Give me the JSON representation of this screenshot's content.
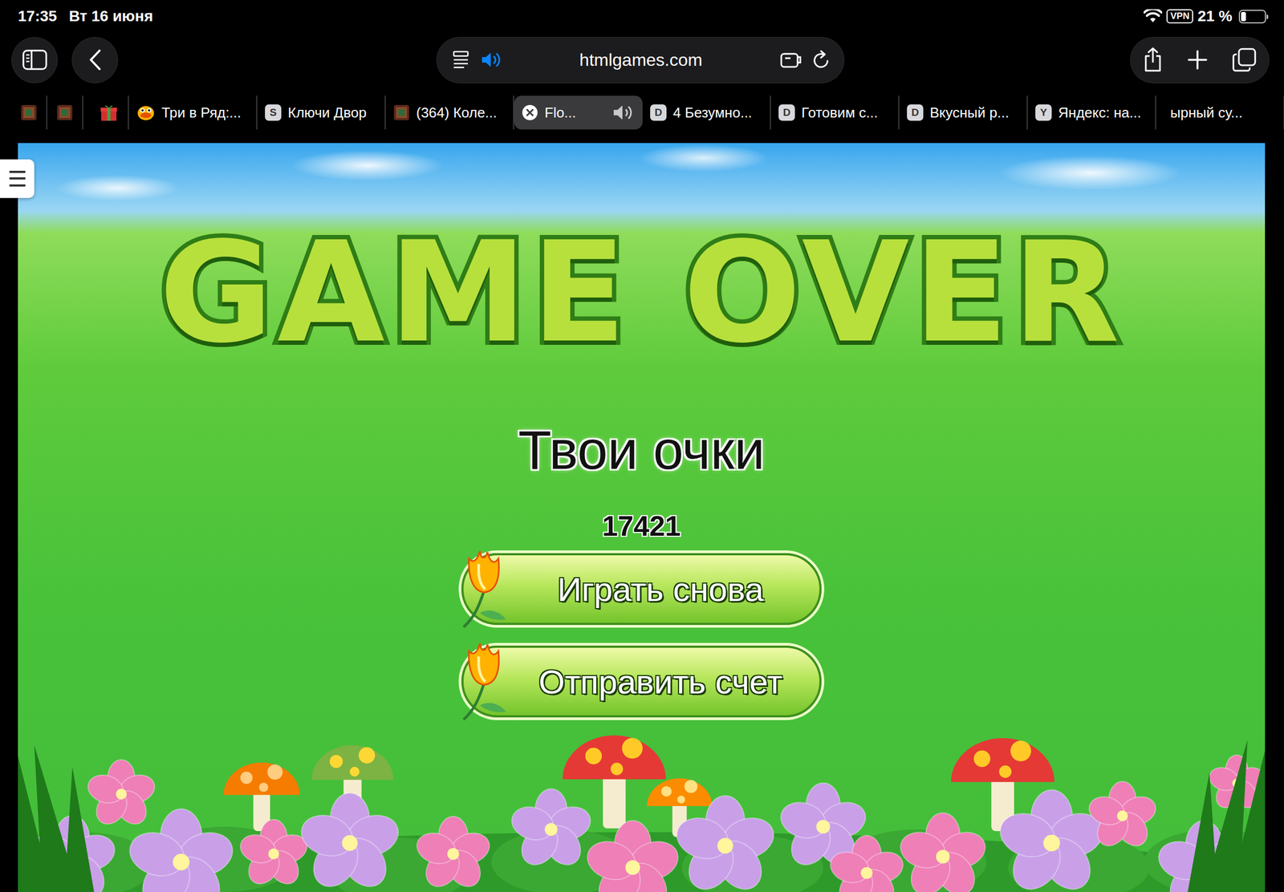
{
  "status_bar": {
    "time": "17:35",
    "date": "Вт 16 июня",
    "vpn": "VPN",
    "battery": "21 %",
    "battery_level": 0.21
  },
  "toolbar": {
    "address": "htmlgames.com",
    "audio_playing": true
  },
  "tabs": [
    {
      "kind": "image",
      "selected": false,
      "audio": false
    },
    {
      "kind": "image",
      "selected": false,
      "audio": false
    },
    {
      "kind": "gift",
      "selected": false,
      "audio": false
    },
    {
      "kind": "bird",
      "label": "Три в Ряд:...",
      "selected": false,
      "audio": false
    },
    {
      "kind": "letter",
      "favicon": "S",
      "label": "Ключи Двор",
      "selected": false,
      "audio": false
    },
    {
      "kind": "image",
      "label": "(364) Коле...",
      "selected": false,
      "audio": false
    },
    {
      "kind": "close",
      "label": "Flo...",
      "selected": true,
      "audio": true
    },
    {
      "kind": "letter",
      "favicon": "D",
      "label": "4 Безумно...",
      "selected": false,
      "audio": false
    },
    {
      "kind": "letter",
      "favicon": "D",
      "label": "Готовим с...",
      "selected": false,
      "audio": false
    },
    {
      "kind": "letter",
      "favicon": "D",
      "label": "Вкусный р...",
      "selected": false,
      "audio": false
    },
    {
      "kind": "letter",
      "favicon": "Y",
      "label": "Яндекс: на...",
      "selected": false,
      "audio": false
    },
    {
      "kind": "none",
      "label": "ырный су...",
      "selected": false,
      "audio": false
    }
  ],
  "game": {
    "menu_icon": "☰",
    "title": "GAME OVER",
    "score_label": "Твои очки",
    "score": "17421",
    "buttons": [
      "Играть снова",
      "Отправить счет"
    ]
  }
}
